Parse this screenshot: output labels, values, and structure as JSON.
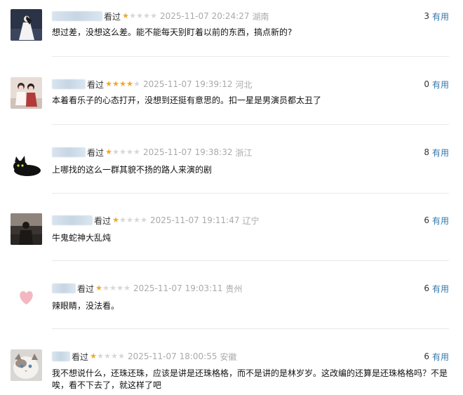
{
  "ui": {
    "watched_label": "看过",
    "useful_label": "有用",
    "star_filled": "★",
    "star_empty": "★",
    "colors": {
      "star_on": "#f5a623",
      "star_off": "#d7d7d7",
      "link": "#3377aa",
      "meta_gray": "#aaaaaa",
      "divider": "#e9e9e9"
    }
  },
  "reviews": [
    {
      "username_visible": "",
      "rating": 1,
      "time": "2025-11-07 20:24:27",
      "location": "湖南",
      "useful_count": "3",
      "content": "想过差，没想这么差。能不能每天别盯着以前的东西，搞点新的?",
      "avatar": "white-dress-figure-icon"
    },
    {
      "username_visible": "",
      "rating": 4,
      "time": "2025-11-07 19:39:12",
      "location": "河北",
      "useful_count": "0",
      "content": "本着看乐子的心态打开，没想到还挺有意思的。扣一星是男演员都太丑了",
      "avatar": "couple-photo-icon"
    },
    {
      "username_visible": "",
      "rating": 1,
      "time": "2025-11-07 19:38:32",
      "location": "浙江",
      "useful_count": "8",
      "content": "上哪找的这么一群其貌不扬的路人来演的剧",
      "avatar": "black-cat-icon"
    },
    {
      "username_visible": "",
      "rating": 1,
      "time": "2025-11-07 19:11:47",
      "location": "辽宁",
      "useful_count": "6",
      "content": "牛鬼蛇神大乱炖",
      "avatar": "dark-silhouette-icon"
    },
    {
      "username_visible": "",
      "rating": 1,
      "time": "2025-11-07 19:03:11",
      "location": "贵州",
      "useful_count": "6",
      "content": "辣眼睛，没法看。",
      "avatar": "pink-heart-icon"
    },
    {
      "username_visible": "",
      "rating": 1,
      "time": "2025-11-07 18:00:55",
      "location": "安徽",
      "useful_count": "6",
      "content": "我不想说什么，还珠还珠，应该是讲是还珠格格，而不是讲的是林岁岁。这改编的还算是还珠格格吗？不是唉，看不下去了，就这样了吧",
      "avatar": "fluffy-cat-icon"
    }
  ]
}
